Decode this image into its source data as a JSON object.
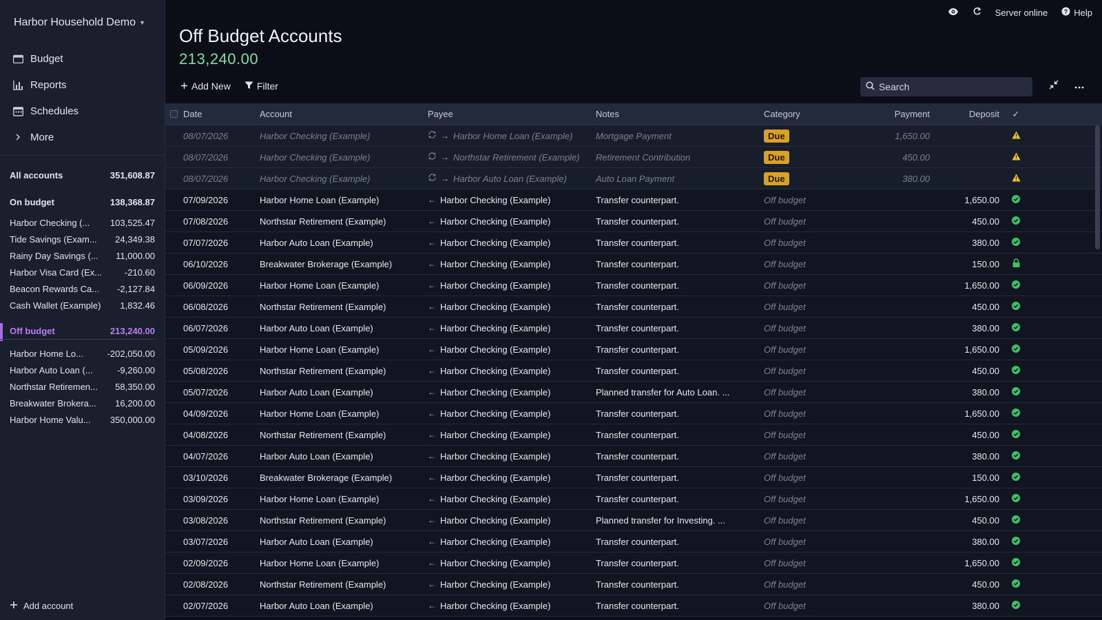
{
  "sidebar": {
    "budget_name": "Harbor Household Demo",
    "nav": [
      {
        "label": "Budget",
        "icon": "wallet-icon"
      },
      {
        "label": "Reports",
        "icon": "bar-chart-icon"
      },
      {
        "label": "Schedules",
        "icon": "calendar-icon"
      },
      {
        "label": "More",
        "icon": "chevron-right-icon"
      }
    ],
    "all_accounts": {
      "name": "All accounts",
      "balance": "351,608.87"
    },
    "on_budget": {
      "name": "On budget",
      "balance": "138,368.87"
    },
    "on_budget_accounts": [
      {
        "name": "Harbor Checking (...",
        "balance": "103,525.47"
      },
      {
        "name": "Tide Savings (Exam...",
        "balance": "24,349.38"
      },
      {
        "name": "Rainy Day Savings (...",
        "balance": "11,000.00"
      },
      {
        "name": "Harbor Visa Card (Ex...",
        "balance": "-210.60"
      },
      {
        "name": "Beacon Rewards Ca...",
        "balance": "-2,127.84"
      },
      {
        "name": "Cash Wallet (Example)",
        "balance": "1,832.46"
      }
    ],
    "off_budget": {
      "name": "Off budget",
      "balance": "213,240.00"
    },
    "off_budget_accounts": [
      {
        "name": "Harbor Home Lo...",
        "balance": "-202,050.00"
      },
      {
        "name": "Harbor Auto Loan (...",
        "balance": "-9,260.00"
      },
      {
        "name": "Northstar Retiremen...",
        "balance": "58,350.00"
      },
      {
        "name": "Breakwater Brokera...",
        "balance": "16,200.00"
      },
      {
        "name": "Harbor Home Valu...",
        "balance": "350,000.00"
      }
    ],
    "add_account": "Add account"
  },
  "topbar": {
    "server_status": "Server online",
    "help": "Help"
  },
  "header": {
    "title": "Off Budget Accounts",
    "balance": "213,240.00",
    "add_new": "Add New",
    "filter": "Filter",
    "search_placeholder": "Search"
  },
  "table": {
    "columns": {
      "date": "Date",
      "account": "Account",
      "payee": "Payee",
      "notes": "Notes",
      "category": "Category",
      "payment": "Payment",
      "deposit": "Deposit",
      "status": "✓"
    },
    "scheduled": [
      {
        "date": "08/07/2026",
        "account": "Harbor Checking (Example)",
        "payee": "Harbor Home Loan (Example)",
        "notes": "Mortgage Payment",
        "category": "Due",
        "payment": "1,650.00",
        "deposit": ""
      },
      {
        "date": "08/07/2026",
        "account": "Harbor Checking (Example)",
        "payee": "Northstar Retirement (Example)",
        "notes": "Retirement Contribution",
        "category": "Due",
        "payment": "450.00",
        "deposit": ""
      },
      {
        "date": "08/07/2026",
        "account": "Harbor Checking (Example)",
        "payee": "Harbor Auto Loan (Example)",
        "notes": "Auto Loan Payment",
        "category": "Due",
        "payment": "380.00",
        "deposit": ""
      }
    ],
    "rows": [
      {
        "date": "07/09/2026",
        "account": "Harbor Home Loan (Example)",
        "payee": "Harbor Checking (Example)",
        "notes": "Transfer counterpart.",
        "category": "Off budget",
        "payment": "",
        "deposit": "1,650.00",
        "status": "cleared"
      },
      {
        "date": "07/08/2026",
        "account": "Northstar Retirement (Example)",
        "payee": "Harbor Checking (Example)",
        "notes": "Transfer counterpart.",
        "category": "Off budget",
        "payment": "",
        "deposit": "450.00",
        "status": "cleared"
      },
      {
        "date": "07/07/2026",
        "account": "Harbor Auto Loan (Example)",
        "payee": "Harbor Checking (Example)",
        "notes": "Transfer counterpart.",
        "category": "Off budget",
        "payment": "",
        "deposit": "380.00",
        "status": "cleared"
      },
      {
        "date": "06/10/2026",
        "account": "Breakwater Brokerage (Example)",
        "payee": "Harbor Checking (Example)",
        "notes": "Transfer counterpart.",
        "category": "Off budget",
        "payment": "",
        "deposit": "150.00",
        "status": "locked"
      },
      {
        "date": "06/09/2026",
        "account": "Harbor Home Loan (Example)",
        "payee": "Harbor Checking (Example)",
        "notes": "Transfer counterpart.",
        "category": "Off budget",
        "payment": "",
        "deposit": "1,650.00",
        "status": "cleared"
      },
      {
        "date": "06/08/2026",
        "account": "Northstar Retirement (Example)",
        "payee": "Harbor Checking (Example)",
        "notes": "Transfer counterpart.",
        "category": "Off budget",
        "payment": "",
        "deposit": "450.00",
        "status": "cleared"
      },
      {
        "date": "06/07/2026",
        "account": "Harbor Auto Loan (Example)",
        "payee": "Harbor Checking (Example)",
        "notes": "Transfer counterpart.",
        "category": "Off budget",
        "payment": "",
        "deposit": "380.00",
        "status": "cleared"
      },
      {
        "date": "05/09/2026",
        "account": "Harbor Home Loan (Example)",
        "payee": "Harbor Checking (Example)",
        "notes": "Transfer counterpart.",
        "category": "Off budget",
        "payment": "",
        "deposit": "1,650.00",
        "status": "cleared"
      },
      {
        "date": "05/08/2026",
        "account": "Northstar Retirement (Example)",
        "payee": "Harbor Checking (Example)",
        "notes": "Transfer counterpart.",
        "category": "Off budget",
        "payment": "",
        "deposit": "450.00",
        "status": "cleared"
      },
      {
        "date": "05/07/2026",
        "account": "Harbor Auto Loan (Example)",
        "payee": "Harbor Checking (Example)",
        "notes": "Planned transfer for Auto Loan. ...",
        "category": "Off budget",
        "payment": "",
        "deposit": "380.00",
        "status": "cleared"
      },
      {
        "date": "04/09/2026",
        "account": "Harbor Home Loan (Example)",
        "payee": "Harbor Checking (Example)",
        "notes": "Transfer counterpart.",
        "category": "Off budget",
        "payment": "",
        "deposit": "1,650.00",
        "status": "cleared"
      },
      {
        "date": "04/08/2026",
        "account": "Northstar Retirement (Example)",
        "payee": "Harbor Checking (Example)",
        "notes": "Transfer counterpart.",
        "category": "Off budget",
        "payment": "",
        "deposit": "450.00",
        "status": "cleared"
      },
      {
        "date": "04/07/2026",
        "account": "Harbor Auto Loan (Example)",
        "payee": "Harbor Checking (Example)",
        "notes": "Transfer counterpart.",
        "category": "Off budget",
        "payment": "",
        "deposit": "380.00",
        "status": "cleared"
      },
      {
        "date": "03/10/2026",
        "account": "Breakwater Brokerage (Example)",
        "payee": "Harbor Checking (Example)",
        "notes": "Transfer counterpart.",
        "category": "Off budget",
        "payment": "",
        "deposit": "150.00",
        "status": "cleared"
      },
      {
        "date": "03/09/2026",
        "account": "Harbor Home Loan (Example)",
        "payee": "Harbor Checking (Example)",
        "notes": "Transfer counterpart.",
        "category": "Off budget",
        "payment": "",
        "deposit": "1,650.00",
        "status": "cleared"
      },
      {
        "date": "03/08/2026",
        "account": "Northstar Retirement (Example)",
        "payee": "Harbor Checking (Example)",
        "notes": "Planned transfer for Investing. ...",
        "category": "Off budget",
        "payment": "",
        "deposit": "450.00",
        "status": "cleared"
      },
      {
        "date": "03/07/2026",
        "account": "Harbor Auto Loan (Example)",
        "payee": "Harbor Checking (Example)",
        "notes": "Transfer counterpart.",
        "category": "Off budget",
        "payment": "",
        "deposit": "380.00",
        "status": "cleared"
      },
      {
        "date": "02/09/2026",
        "account": "Harbor Home Loan (Example)",
        "payee": "Harbor Checking (Example)",
        "notes": "Transfer counterpart.",
        "category": "Off budget",
        "payment": "",
        "deposit": "1,650.00",
        "status": "cleared"
      },
      {
        "date": "02/08/2026",
        "account": "Northstar Retirement (Example)",
        "payee": "Harbor Checking (Example)",
        "notes": "Transfer counterpart.",
        "category": "Off budget",
        "payment": "",
        "deposit": "450.00",
        "status": "cleared"
      },
      {
        "date": "02/07/2026",
        "account": "Harbor Auto Loan (Example)",
        "payee": "Harbor Checking (Example)",
        "notes": "Transfer counterpart.",
        "category": "Off budget",
        "payment": "",
        "deposit": "380.00",
        "status": "cleared"
      }
    ]
  },
  "colors": {
    "accent": "#a66bf0",
    "balance_positive": "#7fe0a5",
    "due_badge": "#d9a224",
    "cleared": "#3fbf6a",
    "warning": "#f0c231"
  }
}
